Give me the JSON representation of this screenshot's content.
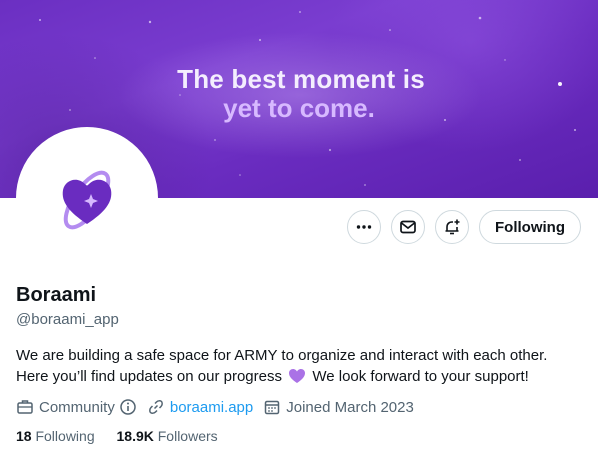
{
  "banner": {
    "line1": "The best moment is",
    "line2": "yet to come.",
    "line2_color": "#d7b9ff",
    "background_color": "#6b2fc2"
  },
  "profile": {
    "name": "Boraami",
    "handle": "@boraami_app",
    "avatar_icon": "purple-heart-orbit-logo",
    "bio_line1": "We are building a safe space for ARMY to organize and interact with each other.",
    "bio_line2_a": "Here you’ll find updates on our progress",
    "bio_emoji": "purple-heart-emoji",
    "bio_line2_b": "We look forward to your support!",
    "category": "Community",
    "website": "boraami.app",
    "joined": "Joined March 2023",
    "following_count": "18",
    "following_label": "Following",
    "followers_count": "18.9K",
    "followers_label": "Followers"
  },
  "actions": {
    "more_icon": "more-icon",
    "message_icon": "envelope-icon",
    "notify_icon": "bell-plus-icon",
    "follow_label": "Following"
  },
  "colors": {
    "accent": "#1d9bf0",
    "purple": "#9b5de5",
    "muted": "#536471"
  }
}
